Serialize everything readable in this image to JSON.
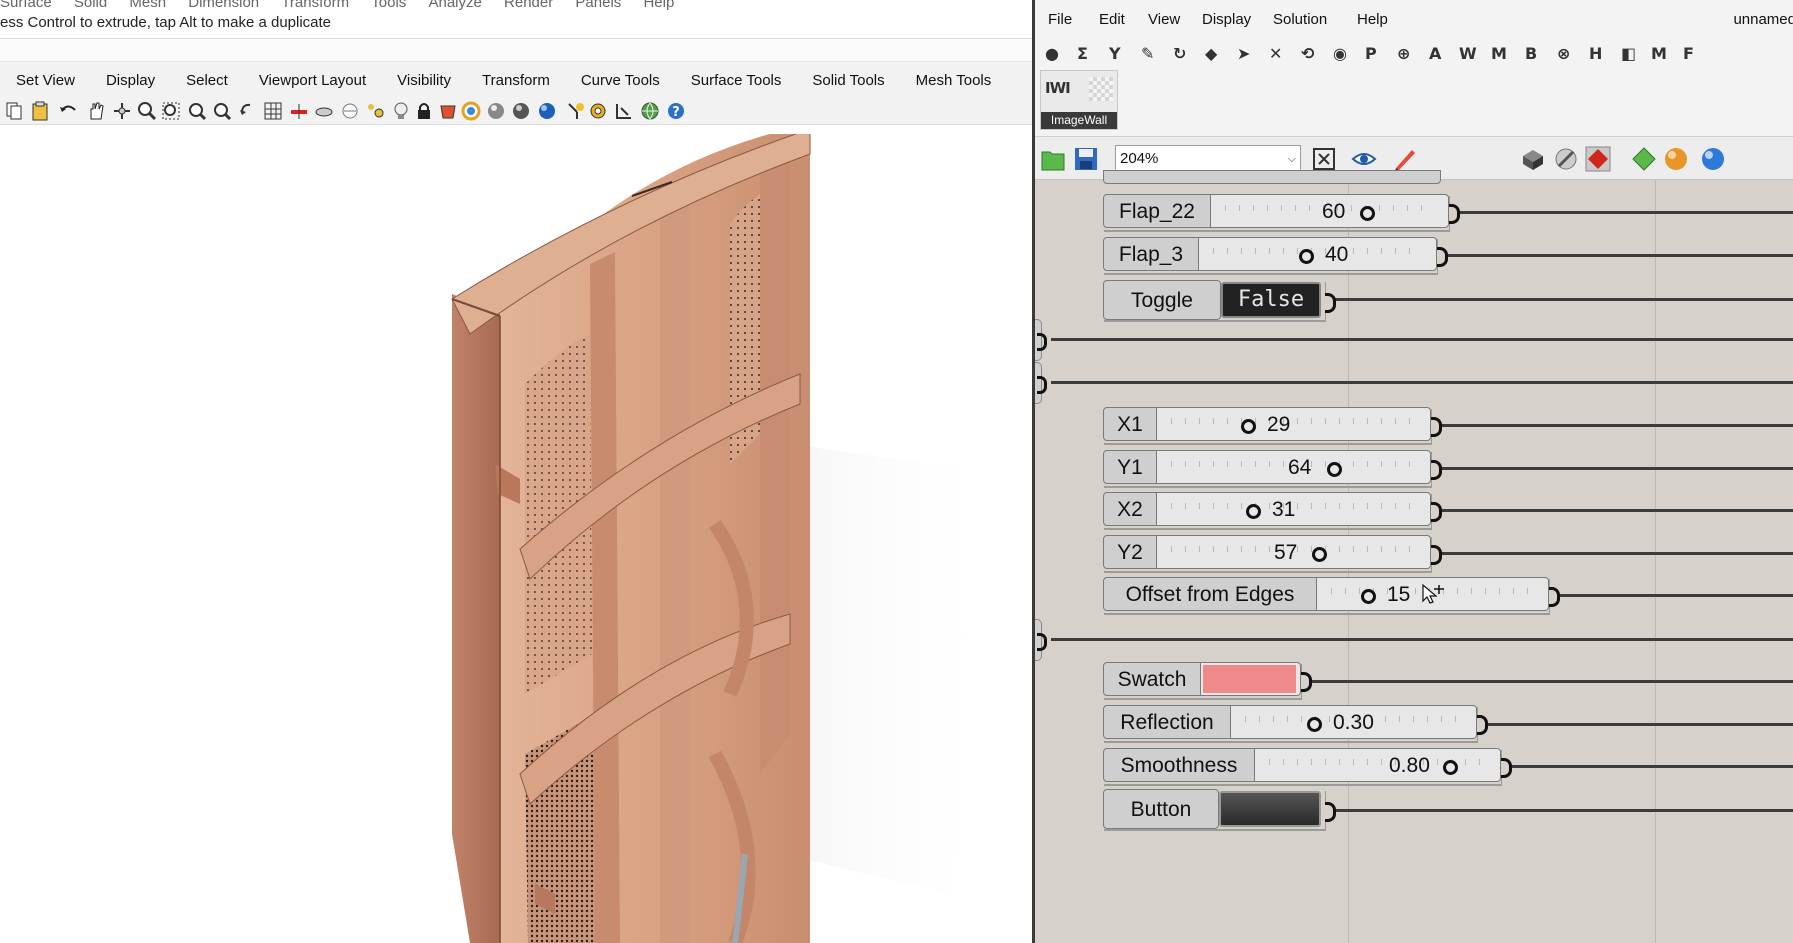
{
  "rhino": {
    "menu": [
      "Surface",
      "Solid",
      "Mesh",
      "Dimension",
      "Transform",
      "Tools",
      "Analyze",
      "Render",
      "Panels",
      "Help"
    ],
    "command_prompt": "ess Control to extrude, tap Alt to make a duplicate",
    "tabs": [
      "Set View",
      "Display",
      "Select",
      "Viewport Layout",
      "Visibility",
      "Transform",
      "Curve Tools",
      "Surface Tools",
      "Solid Tools",
      "Mesh Tools"
    ]
  },
  "gh": {
    "menu": [
      "File",
      "Edit",
      "View",
      "Display",
      "Solution",
      "Help"
    ],
    "title": "unnamed",
    "component_glyphs": [
      "●",
      "Σ",
      "Y",
      "✎",
      "↻",
      "◆",
      "➤",
      "✕",
      "⟲",
      "◉",
      "P",
      "⊕",
      "A",
      "W",
      "M",
      "B",
      "⊗",
      "H",
      "◧",
      "M",
      "F"
    ],
    "tab_label": "ImageWall",
    "tab_logo": "IWI",
    "zoom": "204%",
    "params": {
      "flap22": {
        "label": "Flap_22",
        "value": "60"
      },
      "flap3": {
        "label": "Flap_3",
        "value": "40"
      },
      "toggle": {
        "label": "Toggle",
        "value": "False"
      },
      "x1": {
        "label": "X1",
        "value": "29"
      },
      "y1": {
        "label": "Y1",
        "value": "64"
      },
      "x2": {
        "label": "X2",
        "value": "31"
      },
      "y2": {
        "label": "Y2",
        "value": "57"
      },
      "offset": {
        "label": "Offset from Edges",
        "value": "15"
      },
      "swatch": {
        "label": "Swatch",
        "color": "#f08a8a"
      },
      "reflection": {
        "label": "Reflection",
        "value": "0.30"
      },
      "smoothness": {
        "label": "Smoothness",
        "value": "0.80"
      },
      "button": {
        "label": "Button"
      }
    }
  }
}
